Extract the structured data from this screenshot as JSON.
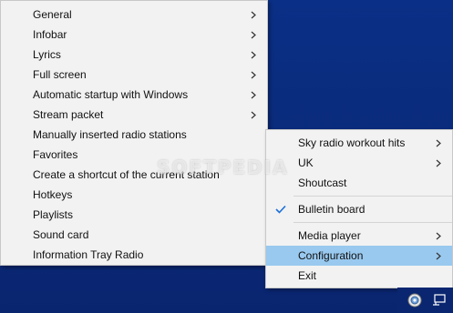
{
  "config_menu": {
    "items": [
      {
        "label": "General",
        "submenu": true
      },
      {
        "label": "Infobar",
        "submenu": true
      },
      {
        "label": "Lyrics",
        "submenu": true
      },
      {
        "label": "Full screen",
        "submenu": true
      },
      {
        "label": "Automatic startup with Windows",
        "submenu": true
      },
      {
        "label": "Stream packet",
        "submenu": true
      },
      {
        "label": "Manually inserted radio stations",
        "submenu": false
      },
      {
        "label": "Favorites",
        "submenu": false
      },
      {
        "label": "Create a shortcut of the current station",
        "submenu": false
      },
      {
        "label": "Hotkeys",
        "submenu": false
      },
      {
        "label": "Playlists",
        "submenu": false
      },
      {
        "label": "Sound card",
        "submenu": false
      },
      {
        "label": "Information Tray Radio",
        "submenu": false
      }
    ]
  },
  "main_menu": {
    "items": [
      {
        "label": "Sky radio workout hits",
        "submenu": true
      },
      {
        "label": "UK",
        "submenu": true
      },
      {
        "label": "Shoutcast",
        "submenu": false
      },
      {
        "label": "Bulletin board",
        "checked": true
      },
      {
        "label": "Media player",
        "submenu": true
      },
      {
        "label": "Configuration",
        "submenu": true,
        "highlighted": true
      },
      {
        "label": "Exit",
        "submenu": false
      }
    ]
  },
  "watermark": "SOFTPEDIA",
  "colors": {
    "desktop": "#0b2a78",
    "menu_bg": "#f2f2f2",
    "highlight": "#99c9ef",
    "check": "#1a6fd8"
  },
  "tray": {
    "icons": [
      "radio-tray-icon",
      "network-icon"
    ]
  }
}
